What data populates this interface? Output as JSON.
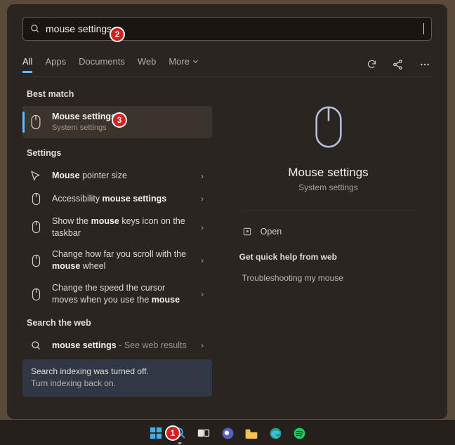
{
  "search": {
    "value": "mouse settings"
  },
  "tabs": {
    "items": [
      "All",
      "Apps",
      "Documents",
      "Web",
      "More"
    ],
    "active": "All"
  },
  "left": {
    "best_match_label": "Best match",
    "best_match": {
      "title": "Mouse settings",
      "subtitle": "System settings"
    },
    "settings_label": "Settings",
    "settings_items": [
      {
        "pre": "",
        "bold": "Mouse",
        "post": " pointer size"
      },
      {
        "pre": "Accessibility ",
        "bold": "mouse settings",
        "post": ""
      },
      {
        "pre": "Show the ",
        "bold": "mouse",
        "post": " keys icon on the taskbar"
      },
      {
        "pre": "Change how far you scroll with the ",
        "bold": "mouse",
        "post": " wheel"
      },
      {
        "pre": "Change the speed the cursor moves when you use the ",
        "bold": "mouse",
        "post": ""
      }
    ],
    "web_label": "Search the web",
    "web_item": {
      "bold": "mouse settings",
      "suffix": " - See web results"
    },
    "notice": {
      "line1": "Search indexing was turned off.",
      "line2": "Turn indexing back on."
    }
  },
  "preview": {
    "title": "Mouse settings",
    "subtitle": "System settings",
    "open_label": "Open",
    "quick_help_label": "Get quick help from web",
    "web_link": "Troubleshooting my mouse"
  },
  "annotations": [
    "1",
    "2",
    "3"
  ]
}
